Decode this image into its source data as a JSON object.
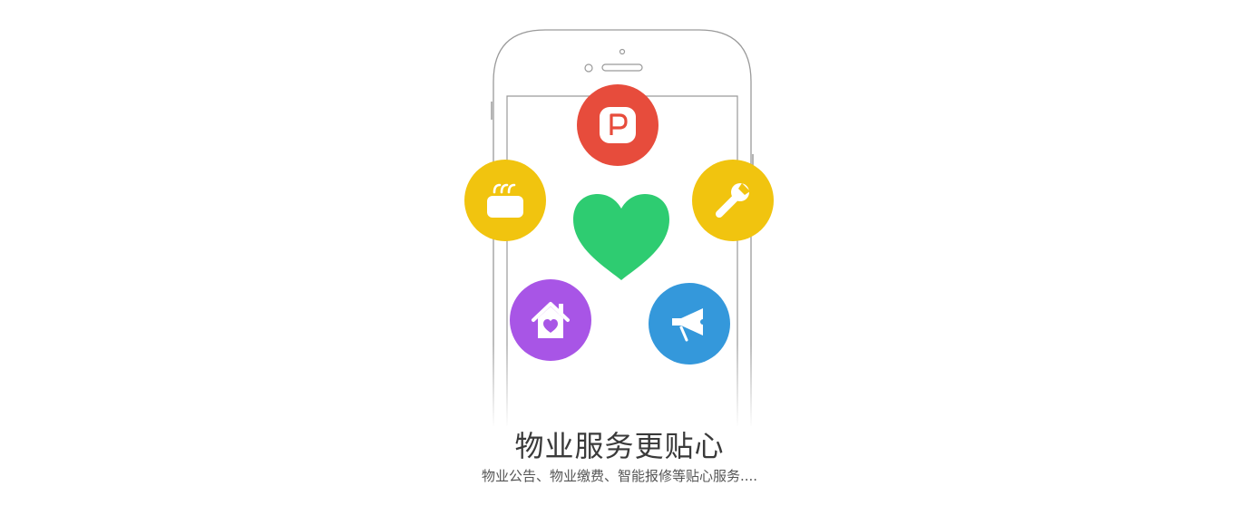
{
  "headline": "物业服务更贴心",
  "subheadline": "物业公告、物业缴费、智能报修等贴心服务....",
  "features": [
    {
      "icon": "parking-icon",
      "color": "#e74c3c"
    },
    {
      "icon": "heater-icon",
      "color": "#f1c40f"
    },
    {
      "icon": "wrench-icon",
      "color": "#f1c40f"
    },
    {
      "icon": "home-heart-icon",
      "color": "#a855e6"
    },
    {
      "icon": "megaphone-icon",
      "color": "#3498db"
    }
  ],
  "heart_color": "#2ecc71",
  "phone_outline_color": "#9a9a9a"
}
